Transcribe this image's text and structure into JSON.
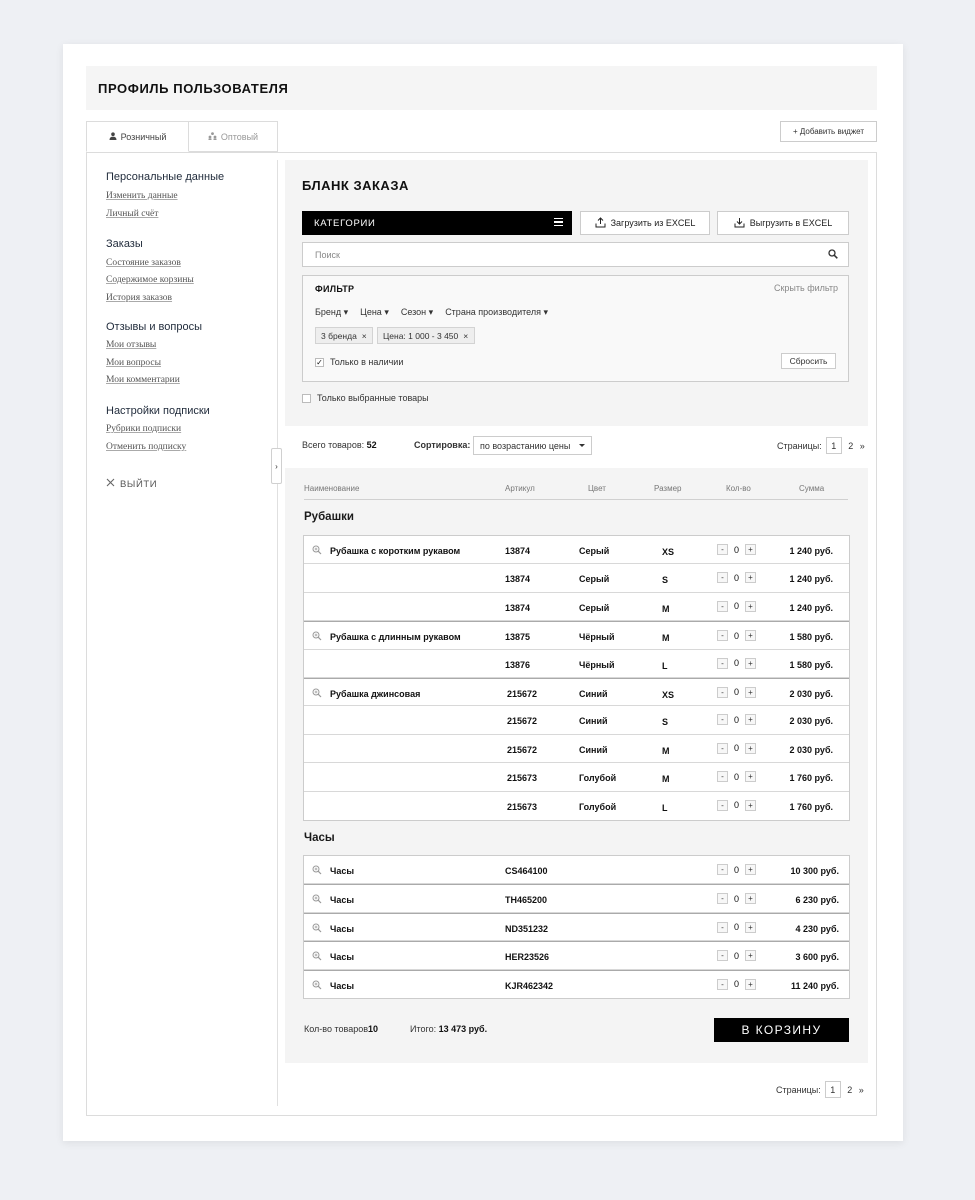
{
  "header": {
    "title": "ПРОФИЛЬ ПОЛЬЗОВАТЕЛЯ"
  },
  "tabs": [
    {
      "label": "Розничный",
      "icon": "person-icon"
    },
    {
      "label": "Оптовый",
      "icon": "group-icon"
    }
  ],
  "add_widget": "+ Добавить виджет",
  "sidebar": {
    "sections": [
      {
        "title": "Персональные данные",
        "links": [
          "Изменить данные",
          "Личный счёт"
        ]
      },
      {
        "title": "Заказы",
        "links": [
          "Состояние заказов",
          "Содержимое корзины",
          "История заказов"
        ]
      },
      {
        "title": "Отзывы и вопросы",
        "links": [
          "Мои отзывы",
          "Мои вопросы",
          "Мои комментарии"
        ]
      },
      {
        "title": "Настройки подписки",
        "links": [
          "Рубрики подписки",
          "Отменить подписку"
        ]
      }
    ],
    "logout": "ВЫЙТИ"
  },
  "order": {
    "title": "БЛАНК ЗАКАЗА",
    "categories": "КАТЕГОРИИ",
    "upload_excel": "Загрузить из EXCEL",
    "download_excel": "Выгрузить в EXCEL",
    "search_placeholder": "Поиск",
    "filter": {
      "title": "ФИЛЬТР",
      "hide": "Скрыть фильтр",
      "options": [
        "Бренд",
        "Цена",
        "Сезон",
        "Страна производителя"
      ],
      "chips": [
        "3 бренда",
        "Цена: 1 000 - 3 450"
      ],
      "in_stock": "Только в наличии",
      "reset": "Сбросить"
    },
    "only_selected": "Только выбранные товары",
    "total_label": "Всего товаров:",
    "total_value": "52",
    "sort_label": "Сортировка:",
    "sort_value": "по возрастанию цены",
    "pages_label": "Страницы:",
    "pages": [
      "1",
      "2"
    ],
    "next": "»"
  },
  "table": {
    "headers": [
      "Наименование",
      "Артикул",
      "Цвет",
      "Размер",
      "Кол-во",
      "Сумма"
    ],
    "groups": [
      {
        "title": "Рубашки",
        "rows": [
          {
            "name": "Рубашка с коротким рукавом",
            "sku": "13874",
            "color": "Серый",
            "size": "XS",
            "qty": "0",
            "sum": "1 240 руб."
          },
          {
            "name": "",
            "sku": "13874",
            "color": "Серый",
            "size": "S",
            "qty": "0",
            "sum": "1 240 руб."
          },
          {
            "name": "",
            "sku": "13874",
            "color": "Серый",
            "size": "M",
            "qty": "0",
            "sum": "1 240 руб."
          },
          {
            "name": "Рубашка с длинным рукавом",
            "sku": "13875",
            "color": "Чёрный",
            "size": "M",
            "qty": "0",
            "sum": "1 580 руб."
          },
          {
            "name": "",
            "sku": "13876",
            "color": "Чёрный",
            "size": "L",
            "qty": "0",
            "sum": "1 580 руб."
          },
          {
            "name": "Рубашка джинсовая",
            "sku": "215672",
            "color": "Синий",
            "size": "XS",
            "qty": "0",
            "sum": "2 030 руб."
          },
          {
            "name": "",
            "sku": "215672",
            "color": "Синий",
            "size": "S",
            "qty": "0",
            "sum": "2 030 руб."
          },
          {
            "name": "",
            "sku": "215672",
            "color": "Синий",
            "size": "M",
            "qty": "0",
            "sum": "2 030 руб."
          },
          {
            "name": "",
            "sku": "215673",
            "color": "Голубой",
            "size": "M",
            "qty": "0",
            "sum": "1 760 руб."
          },
          {
            "name": "",
            "sku": "215673",
            "color": "Голубой",
            "size": "L",
            "qty": "0",
            "sum": "1 760 руб."
          }
        ]
      },
      {
        "title": "Часы",
        "rows": [
          {
            "name": "Часы",
            "sku": "CS464100",
            "color": "",
            "size": "",
            "qty": "0",
            "sum": "10 300 руб."
          },
          {
            "name": "Часы",
            "sku": "TH465200",
            "color": "",
            "size": "",
            "qty": "0",
            "sum": "6 230 руб."
          },
          {
            "name": "Часы",
            "sku": "ND351232",
            "color": "",
            "size": "",
            "qty": "0",
            "sum": "4 230 руб."
          },
          {
            "name": "Часы",
            "sku": "HER23526",
            "color": "",
            "size": "",
            "qty": "0",
            "sum": "3 600 руб."
          },
          {
            "name": "Часы",
            "sku": "KJR462342",
            "color": "",
            "size": "",
            "qty": "0",
            "sum": "11 240 руб."
          }
        ]
      }
    ]
  },
  "footer": {
    "qty_label": "Кол-во товаров",
    "qty_value": "10",
    "total_label": "Итого:",
    "total_value": "13 473 руб.",
    "cart_button": "В КОРЗИНУ"
  }
}
